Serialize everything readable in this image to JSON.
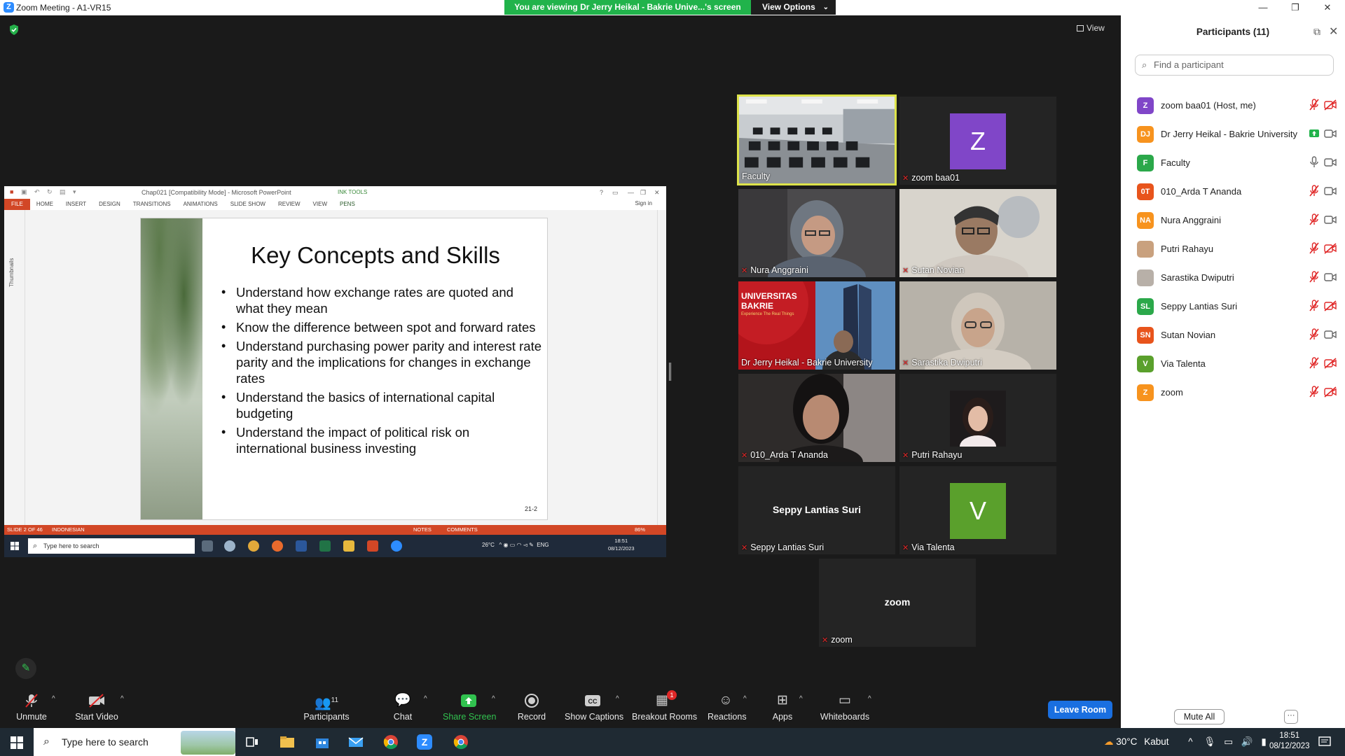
{
  "window": {
    "title": "Zoom Meeting - A1-VR15",
    "controls": [
      "—",
      "❐",
      "✕"
    ]
  },
  "share_banner": {
    "text": "You are viewing Dr Jerry Heikal - Bakrie Unive...'s screen",
    "view_options": "View Options"
  },
  "view_button": "View",
  "shared_screen": {
    "app_title": "Chap021 [Compatibility Mode] - Microsoft PowerPoint",
    "ink_tools": "INK TOOLS",
    "ribbon_tabs": [
      "FILE",
      "HOME",
      "INSERT",
      "DESIGN",
      "TRANSITIONS",
      "ANIMATIONS",
      "SLIDE SHOW",
      "REVIEW",
      "VIEW",
      "PENS"
    ],
    "sign_in": "Sign in",
    "thumbnails_label": "Thumbnails",
    "slide": {
      "title": "Key Concepts and Skills",
      "bullets": [
        "Understand how exchange rates are quoted and what they mean",
        "Know the difference between spot and forward rates",
        "Understand purchasing power parity and interest rate parity and the implications for changes in exchange rates",
        "Understand the basics of international capital budgeting",
        "Understand the impact of political risk on international business investing"
      ],
      "page_number": "21-2"
    },
    "status": {
      "slide_of": "SLIDE 2 OF 46",
      "language": "INDONESIAN",
      "notes": "NOTES",
      "comments": "COMMENTS",
      "zoom": "86%"
    },
    "taskbar": {
      "search_placeholder": "Type here to search",
      "weather": "26°C",
      "lang": "ENG",
      "time": "18:51",
      "date": "08/12/2023"
    }
  },
  "video_tiles": [
    {
      "name": "Faculty",
      "muted": false,
      "active": true
    },
    {
      "name": "zoom baa01",
      "muted": true,
      "avatar": "Z",
      "avatar_color": "#8046c8"
    },
    {
      "name": "Nura Anggraini",
      "muted": true
    },
    {
      "name": "Sutan Novian",
      "muted": true
    },
    {
      "name": "Dr Jerry Heikal - Bakrie University",
      "muted": false,
      "banner_title": "UNIVERSITAS BAKRIE",
      "banner_sub": "Experience The Real Things"
    },
    {
      "name": "Sarastika Dwiputri",
      "muted": true
    },
    {
      "name": "010_Arda T Ananda",
      "muted": true
    },
    {
      "name": "Putri Rahayu",
      "muted": true
    },
    {
      "name": "Seppy Lantias Suri",
      "muted": true,
      "center_text": "Seppy Lantias Suri"
    },
    {
      "name": "Via Talenta",
      "muted": true,
      "avatar": "V",
      "avatar_color": "#5aa02c"
    },
    {
      "name": "zoom",
      "muted": true,
      "center_text": "zoom"
    }
  ],
  "participants_panel": {
    "title": "Participants (11)",
    "search_placeholder": "Find a participant",
    "participants": [
      {
        "initials": "Z",
        "name": "zoom baa01 (Host, me)",
        "color": "#8046c8",
        "mic": "muted",
        "video": "off"
      },
      {
        "initials": "DJ",
        "name": "Dr Jerry Heikal - Bakrie University",
        "color": "#f7931e",
        "mic": "sharing",
        "video": "on"
      },
      {
        "initials": "F",
        "name": "Faculty",
        "color": "#2ba84a",
        "mic": "on",
        "video": "on"
      },
      {
        "initials": "0T",
        "name": "010_Arda T Ananda",
        "color": "#e8541c",
        "mic": "muted",
        "video": "on"
      },
      {
        "initials": "NA",
        "name": "Nura Anggraini",
        "color": "#f7931e",
        "mic": "muted",
        "video": "on"
      },
      {
        "initials": "",
        "name": "Putri Rahayu",
        "color": "#c9a17e",
        "mic": "muted",
        "video": "off"
      },
      {
        "initials": "",
        "name": "Sarastika Dwiputri",
        "color": "#b8b0a8",
        "mic": "muted",
        "video": "on"
      },
      {
        "initials": "SL",
        "name": "Seppy Lantias Suri",
        "color": "#2ba84a",
        "mic": "muted",
        "video": "off"
      },
      {
        "initials": "SN",
        "name": "Sutan Novian",
        "color": "#e8541c",
        "mic": "muted",
        "video": "on"
      },
      {
        "initials": "V",
        "name": "Via Talenta",
        "color": "#5aa02c",
        "mic": "muted",
        "video": "off"
      },
      {
        "initials": "Z",
        "name": "zoom",
        "color": "#f7931e",
        "mic": "muted",
        "video": "off"
      }
    ],
    "mute_all": "Mute All",
    "more": "···"
  },
  "toolbar": {
    "unmute": "Unmute",
    "start_video": "Start Video",
    "participants": "Participants",
    "participants_count": "11",
    "chat": "Chat",
    "share_screen": "Share Screen",
    "record": "Record",
    "show_captions": "Show Captions",
    "breakout_rooms": "Breakout Rooms",
    "breakout_badge": "1",
    "reactions": "Reactions",
    "apps": "Apps",
    "whiteboards": "Whiteboards",
    "leave_room": "Leave Room"
  },
  "taskbar": {
    "search_placeholder": "Type here to search",
    "weather": "30°C",
    "weather_desc": "Kabut",
    "time": "18:51",
    "date": "08/12/2023"
  },
  "colors": {
    "zoom_blue": "#2d8cff",
    "banner_green": "#21b34b",
    "leave_blue": "#1a6fe0",
    "ppt_red": "#d24726",
    "muted_red": "#e02828"
  }
}
